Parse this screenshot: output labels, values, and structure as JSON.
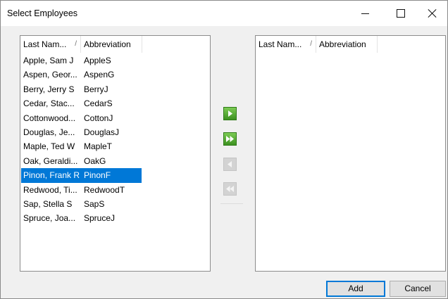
{
  "window": {
    "title": "Select Employees",
    "controls": {
      "minimize": "minimize-icon",
      "maximize": "maximize-icon",
      "close": "close-icon"
    }
  },
  "left_list": {
    "columns": [
      {
        "label": "Last Nam...",
        "sort_indicator": "/"
      },
      {
        "label": "Abbreviation"
      }
    ],
    "rows": [
      {
        "name": "Apple, Sam J",
        "abbr": "AppleS"
      },
      {
        "name": "Aspen, Geor...",
        "abbr": "AspenG"
      },
      {
        "name": "Berry, Jerry S",
        "abbr": "BerryJ"
      },
      {
        "name": "Cedar, Stac...",
        "abbr": "CedarS"
      },
      {
        "name": "Cottonwood...",
        "abbr": "CottonJ"
      },
      {
        "name": "Douglas, Je...",
        "abbr": "DouglasJ"
      },
      {
        "name": "Maple, Ted W",
        "abbr": "MapleT"
      },
      {
        "name": "Oak, Geraldi...",
        "abbr": "OakG"
      },
      {
        "name": "Pinon, Frank R",
        "abbr": "PinonF",
        "selected": true
      },
      {
        "name": "Redwood, Ti...",
        "abbr": "RedwoodT"
      },
      {
        "name": "Sap, Stella S",
        "abbr": "SapS"
      },
      {
        "name": "Spruce, Joa...",
        "abbr": "SpruceJ"
      }
    ]
  },
  "right_list": {
    "columns": [
      {
        "label": "Last Nam...",
        "sort_indicator": "/"
      },
      {
        "label": "Abbreviation"
      }
    ],
    "rows": []
  },
  "transfer_buttons": [
    {
      "icon": "move-right-icon",
      "enabled": true
    },
    {
      "icon": "move-all-right-icon",
      "enabled": true
    },
    {
      "icon": "move-left-icon",
      "enabled": false
    },
    {
      "icon": "move-all-left-icon",
      "enabled": false
    }
  ],
  "footer": {
    "add_label": "Add",
    "cancel_label": "Cancel"
  },
  "colors": {
    "selection": "#0078d7",
    "arrow_enabled": "#4ea82e",
    "arrow_disabled": "#d3d3d3",
    "default_button_border": "#0078d7"
  }
}
